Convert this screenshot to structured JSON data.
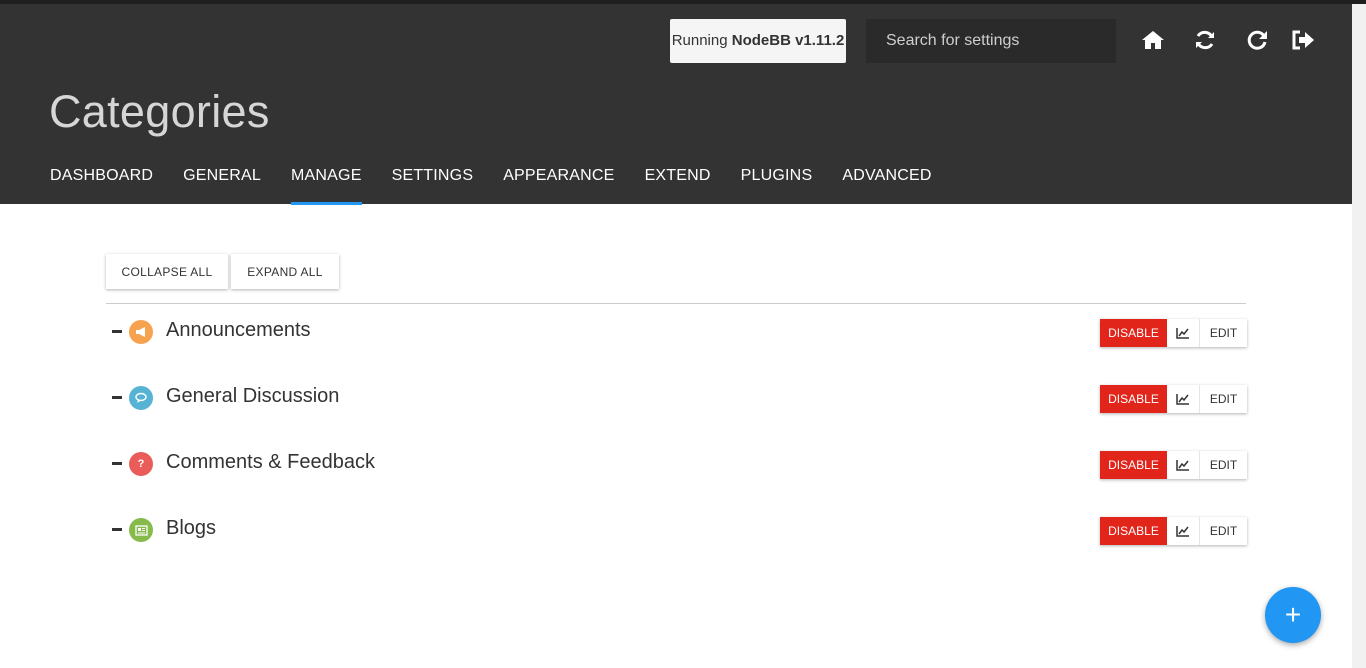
{
  "header": {
    "version_prefix": "Running",
    "version_name": "NodeBB v1.11.2",
    "search_placeholder": "Search for settings",
    "icons": [
      "home-icon",
      "rebuild-icon",
      "restart-icon",
      "logout-icon"
    ]
  },
  "page": {
    "title": "Categories"
  },
  "nav": {
    "tabs": [
      {
        "label": "DASHBOARD"
      },
      {
        "label": "GENERAL"
      },
      {
        "label": "MANAGE",
        "active": true
      },
      {
        "label": "SETTINGS"
      },
      {
        "label": "APPEARANCE"
      },
      {
        "label": "EXTEND"
      },
      {
        "label": "PLUGINS"
      },
      {
        "label": "ADVANCED"
      }
    ]
  },
  "toolbar": {
    "collapse_label": "COLLAPSE ALL",
    "expand_label": "EXPAND ALL"
  },
  "categories": [
    {
      "name": "Announcements",
      "icon": "bullhorn-icon",
      "color": "#f6a24f",
      "disable_label": "DISABLE",
      "edit_label": "EDIT"
    },
    {
      "name": "General Discussion",
      "icon": "comments-icon",
      "color": "#56b3d4",
      "disable_label": "DISABLE",
      "edit_label": "EDIT"
    },
    {
      "name": "Comments & Feedback",
      "icon": "question-icon",
      "color": "#e95c5a",
      "disable_label": "DISABLE",
      "edit_label": "EDIT"
    },
    {
      "name": "Blogs",
      "icon": "newspaper-icon",
      "color": "#86ba4b",
      "disable_label": "DISABLE",
      "edit_label": "EDIT"
    }
  ],
  "fab": {
    "label": "+"
  },
  "colors": {
    "header_bg": "#333333",
    "accent": "#2196f3",
    "danger": "#e1251b"
  }
}
